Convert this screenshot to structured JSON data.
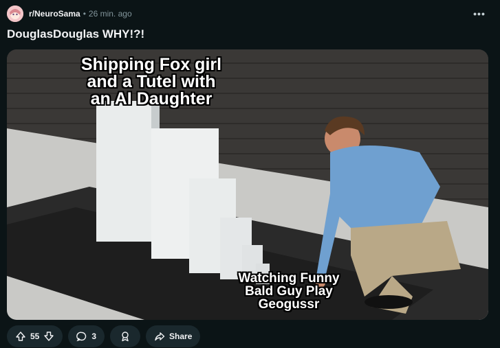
{
  "post": {
    "subreddit": "r/NeuroSama",
    "separator": "•",
    "time": "26 min. ago",
    "more_label": "•••",
    "title": "DouglasDouglas WHY!?!"
  },
  "meme": {
    "top_caption": "Shipping Fox girl and a Tutel with an AI Daughter",
    "bottom_caption": "Watching Funny Bald Guy Play Geogussr"
  },
  "actions": {
    "upvotes": "55",
    "comments": "3",
    "share_label": "Share"
  },
  "icons": {
    "upvote": "upvote-arrow-icon",
    "downvote": "downvote-arrow-icon",
    "comment": "comment-bubble-icon",
    "award": "award-icon",
    "share": "share-arrow-icon",
    "more": "more-dots-icon"
  },
  "colors": {
    "background": "#0b1416",
    "pill": "#1a282d",
    "muted_text": "#82959b"
  }
}
